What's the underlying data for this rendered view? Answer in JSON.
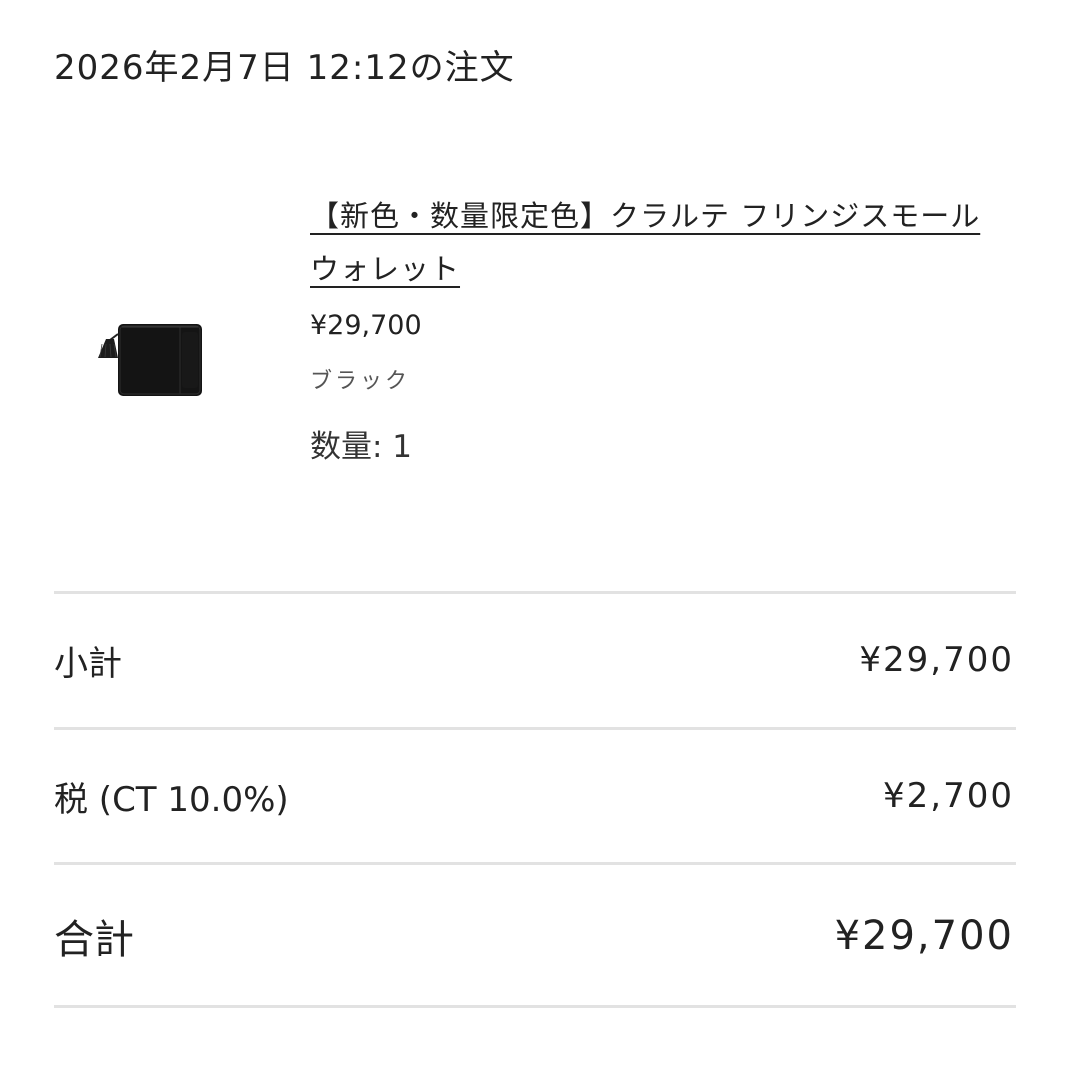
{
  "order": {
    "title": "2026年2月7日 12:12の注文"
  },
  "item": {
    "name": "【新色・数量限定色】クラルテ フリンジスモールウォレット",
    "price": "¥29,700",
    "variant": "ブラック",
    "quantity": "数量: 1",
    "image_icon": "black-wallet-with-tassel",
    "colors": {
      "wallet": "#141414",
      "tassel": "#1c1c1c"
    }
  },
  "summary": {
    "subtotal_label": "小計",
    "subtotal_value": "¥29,700",
    "tax_label": "税 (CT 10.0%)",
    "tax_value": "¥2,700",
    "total_label": "合計",
    "total_value": "¥29,700"
  },
  "colors": {
    "text": "#222222",
    "divider": "#e2e2e2",
    "background": "#ffffff"
  }
}
